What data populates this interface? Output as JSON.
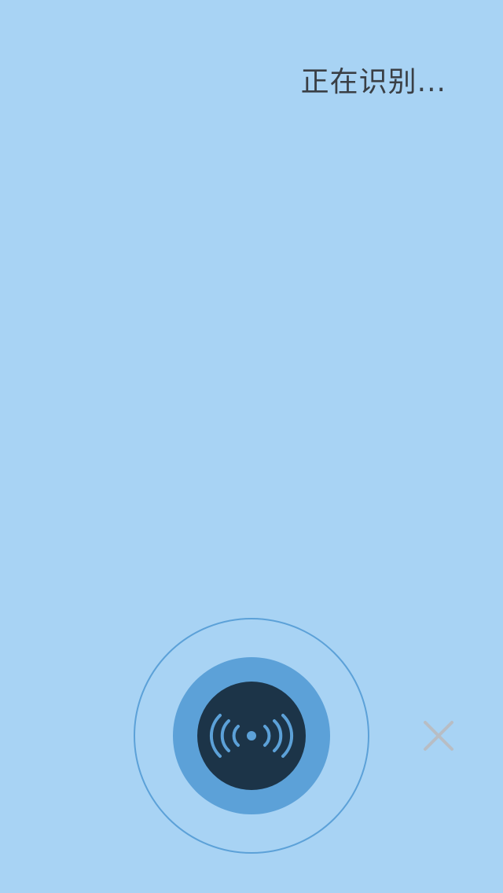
{
  "status": {
    "text": "正在识别..."
  },
  "controls": {
    "mic_icon": "broadcast-signal-icon",
    "close_icon": "close-icon"
  },
  "colors": {
    "background": "#a8d3f4",
    "ring": "#5ca1d8",
    "button": "#1c3448",
    "icon": "#5ca1d8",
    "close": "#b8bdc4",
    "text": "#3a3f45"
  }
}
